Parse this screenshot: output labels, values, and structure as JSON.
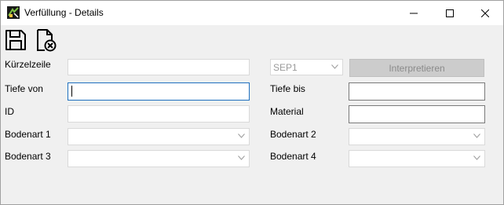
{
  "window": {
    "title": "Verfüllung - Details",
    "controls": [
      "minimize-icon",
      "maximize-icon",
      "close-icon"
    ]
  },
  "toolbar": {
    "buttons": [
      {
        "name": "save",
        "icon": "floppy-disk-icon"
      },
      {
        "name": "discard",
        "icon": "document-cancel-icon"
      }
    ]
  },
  "form": {
    "kurzelzeile_label": "Kürzelzeile",
    "kurzelzeile_value": "",
    "format_select": "SEP1",
    "interpret_button": "Interpretieren",
    "tiefe_von_label": "Tiefe von",
    "tiefe_von_value": "",
    "tiefe_bis_label": "Tiefe bis",
    "tiefe_bis_value": "",
    "id_label": "ID",
    "id_value": "",
    "material_label": "Material",
    "material_value": "",
    "bodenart1_label": "Bodenart 1",
    "bodenart1_value": "",
    "bodenart2_label": "Bodenart 2",
    "bodenart2_value": "",
    "bodenart3_label": "Bodenart 3",
    "bodenart3_value": "",
    "bodenart4_label": "Bodenart 4",
    "bodenart4_value": ""
  },
  "colors": {
    "window_bg": "#f0f0f0",
    "titlebar_bg": "#ffffff",
    "focus_border": "#1e6fbf",
    "disabled_button_bg": "#cccccc",
    "disabled_text": "#8a8a8a"
  }
}
